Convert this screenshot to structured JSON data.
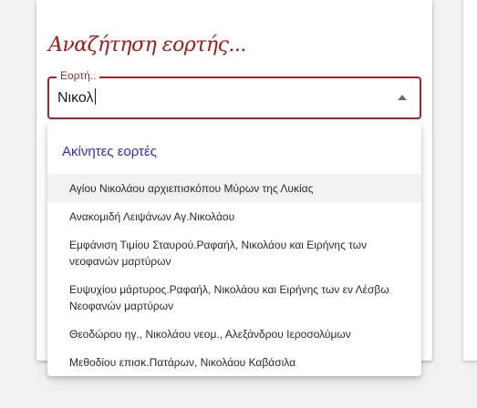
{
  "search": {
    "title": "Αναζήτηση εορτής...",
    "label": "Εορτή..",
    "value": "Νικολ"
  },
  "dropdown": {
    "group_header": "Ακίνητες εορτές",
    "items": [
      {
        "label": "Αγίου Νικολάου αρχιεπισκόπου Μύρων της Λυκίας",
        "highlighted": true
      },
      {
        "label": "Ανακομιδή Λειψάνων Αγ.Νικολάου",
        "highlighted": false
      },
      {
        "label": "Εμφάνιση Τιμίου Σταυρού.Ραφαήλ, Νικολάου και Ειρήνης των νεοφανών μαρτύρων",
        "highlighted": false
      },
      {
        "label": "Ευψυχίου μάρτυρος.Ραφαήλ, Νικολάου και Ειρήνης των εν Λέσβω Νεοφανών μαρτύρων",
        "highlighted": false
      },
      {
        "label": "Θεοδώρου ηγ., Νικολάου νεομ., Αλεξάνδρου Ιεροσολύμων",
        "highlighted": false
      },
      {
        "label": "Μεθοδίου επισκ.Πατάρων, Νικολάου Καβάσιλα",
        "highlighted": false
      }
    ]
  },
  "colors": {
    "accent": "#a52427",
    "title": "#9b1b1b",
    "group_header": "#2b2bd6",
    "highlight_bg": "#f2f2f2"
  }
}
